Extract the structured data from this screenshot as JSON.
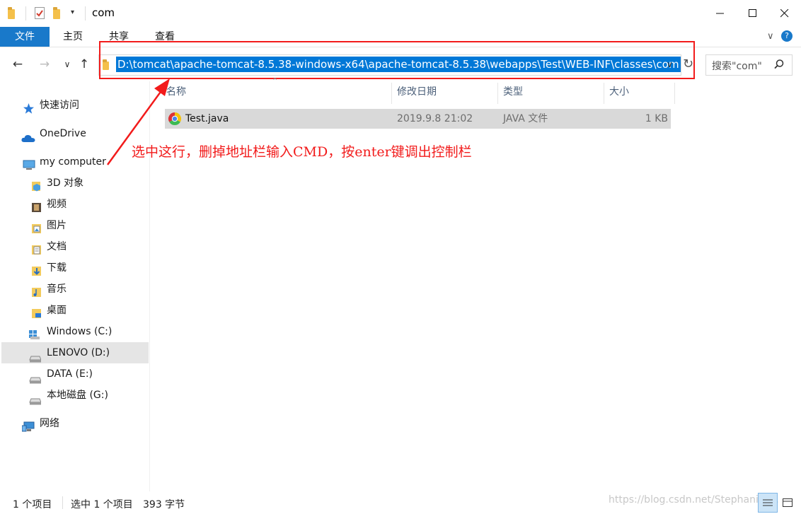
{
  "window": {
    "title": "com",
    "minimize_glyph": "—",
    "maximize_glyph": "☐",
    "close_glyph": "✕"
  },
  "ribbon": {
    "tabs": [
      "文件",
      "主页",
      "共享",
      "查看"
    ]
  },
  "navigation": {
    "back_glyph": "←",
    "forward_glyph": "→",
    "recent_glyph": "∨",
    "up_glyph": "↑"
  },
  "address": {
    "path": "D:\\tomcat\\apache-tomcat-8.5.38-windows-x64\\apache-tomcat-8.5.38\\webapps\\Test\\WEB-INF\\classes\\com",
    "dropdown_glyph": "∨",
    "refresh_glyph": "↻"
  },
  "search": {
    "placeholder": "搜索\"com\""
  },
  "sidebar": {
    "items": [
      {
        "label": "快速访问",
        "icon": "star-icon"
      },
      {
        "label": "OneDrive",
        "icon": "cloud-icon"
      },
      {
        "label": "my computer",
        "icon": "computer-icon"
      },
      {
        "label": "3D 对象",
        "icon": "3d-objects-icon"
      },
      {
        "label": "视频",
        "icon": "video-icon"
      },
      {
        "label": "图片",
        "icon": "pictures-icon"
      },
      {
        "label": "文档",
        "icon": "documents-icon"
      },
      {
        "label": "下载",
        "icon": "downloads-icon"
      },
      {
        "label": "音乐",
        "icon": "music-icon"
      },
      {
        "label": "桌面",
        "icon": "desktop-icon"
      },
      {
        "label": "Windows (C:)",
        "icon": "windows-drive-icon"
      },
      {
        "label": "LENOVO (D:)",
        "icon": "drive-icon",
        "selected": true
      },
      {
        "label": "DATA (E:)",
        "icon": "drive-icon"
      },
      {
        "label": "本地磁盘 (G:)",
        "icon": "drive-icon"
      },
      {
        "label": "网络",
        "icon": "network-icon"
      }
    ]
  },
  "file_list": {
    "columns": [
      "名称",
      "修改日期",
      "类型",
      "大小"
    ],
    "rows": [
      {
        "name": "Test.java",
        "modified": "2019.9.8 21:02",
        "type": "JAVA 文件",
        "size": "1 KB",
        "icon": "chrome-icon"
      }
    ]
  },
  "annotation": {
    "text": "选中这行，删掉地址栏输入CMD，按enter键调出控制栏",
    "color": "#f21b1b"
  },
  "status": {
    "item_count": "1 个项目",
    "selection": "选中 1 个项目",
    "selection_size": "393 字节"
  },
  "watermark": "https://blog.csdn.net/Stephanie_..."
}
